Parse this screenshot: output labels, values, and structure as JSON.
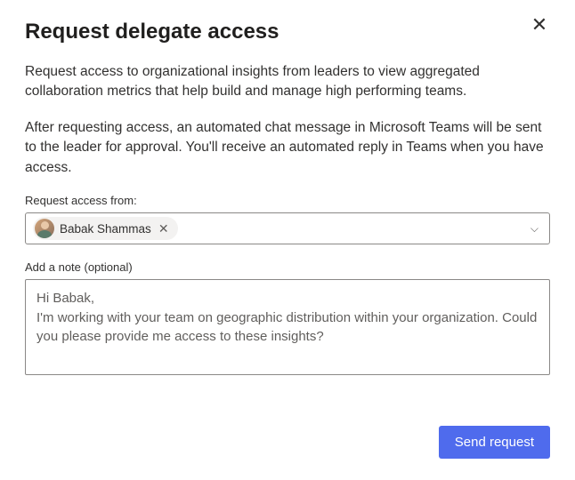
{
  "dialog": {
    "title": "Request delegate access",
    "description1": "Request access to organizational insights from leaders to view aggregated collaboration metrics that help build and manage high performing teams.",
    "description2": "After requesting access, an automated chat message in Microsoft Teams will be sent to the leader for approval. You'll receive an automated reply in Teams when you have access."
  },
  "fields": {
    "accessFrom": {
      "label": "Request access from:",
      "selected": [
        {
          "name": "Babak Shammas"
        }
      ]
    },
    "note": {
      "label": "Add a note (optional)",
      "value": "Hi Babak,\nI'm working with your team on geographic distribution within your organization. Could you please provide me access to these insights?"
    }
  },
  "actions": {
    "send": "Send request"
  },
  "icons": {
    "close": "✕",
    "chipRemove": "✕",
    "chevronDown": "⌵"
  }
}
